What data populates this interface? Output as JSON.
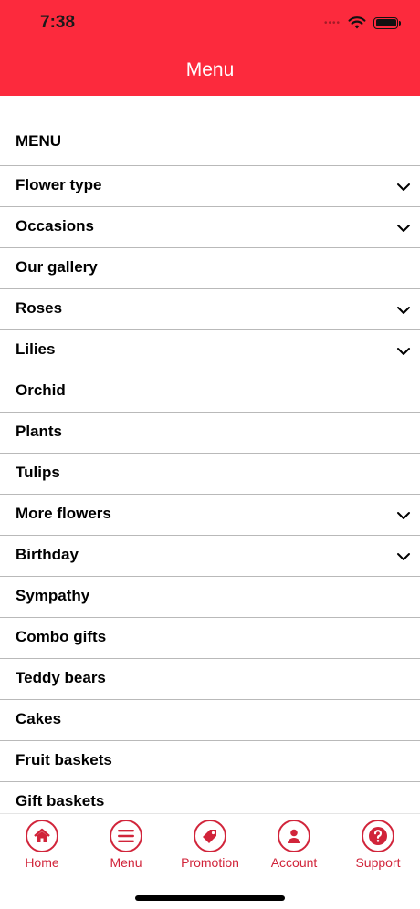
{
  "status_bar": {
    "time": "7:38"
  },
  "header": {
    "title": "Menu"
  },
  "menu": {
    "section_title": "MENU",
    "items": [
      {
        "label": "Flower type",
        "expandable": true
      },
      {
        "label": "Occasions",
        "expandable": true
      },
      {
        "label": "Our gallery",
        "expandable": false
      },
      {
        "label": "Roses",
        "expandable": true
      },
      {
        "label": "Lilies",
        "expandable": true
      },
      {
        "label": "Orchid",
        "expandable": false
      },
      {
        "label": "Plants",
        "expandable": false
      },
      {
        "label": "Tulips",
        "expandable": false
      },
      {
        "label": "More flowers",
        "expandable": true
      },
      {
        "label": "Birthday",
        "expandable": true
      },
      {
        "label": "Sympathy",
        "expandable": false
      },
      {
        "label": "Combo gifts",
        "expandable": false
      },
      {
        "label": "Teddy bears",
        "expandable": false
      },
      {
        "label": "Cakes",
        "expandable": false
      },
      {
        "label": "Fruit baskets",
        "expandable": false
      },
      {
        "label": "Gift baskets",
        "expandable": false
      }
    ]
  },
  "tabbar": {
    "tabs": [
      {
        "label": "Home",
        "icon": "home-icon"
      },
      {
        "label": "Menu",
        "icon": "menu-icon"
      },
      {
        "label": "Promotion",
        "icon": "tag-icon"
      },
      {
        "label": "Account",
        "icon": "account-icon"
      },
      {
        "label": "Support",
        "icon": "help-icon"
      }
    ]
  },
  "colors": {
    "brand": "#fc2a3d",
    "tab_accent": "#d1243a",
    "divider": "#b9b9b9"
  }
}
